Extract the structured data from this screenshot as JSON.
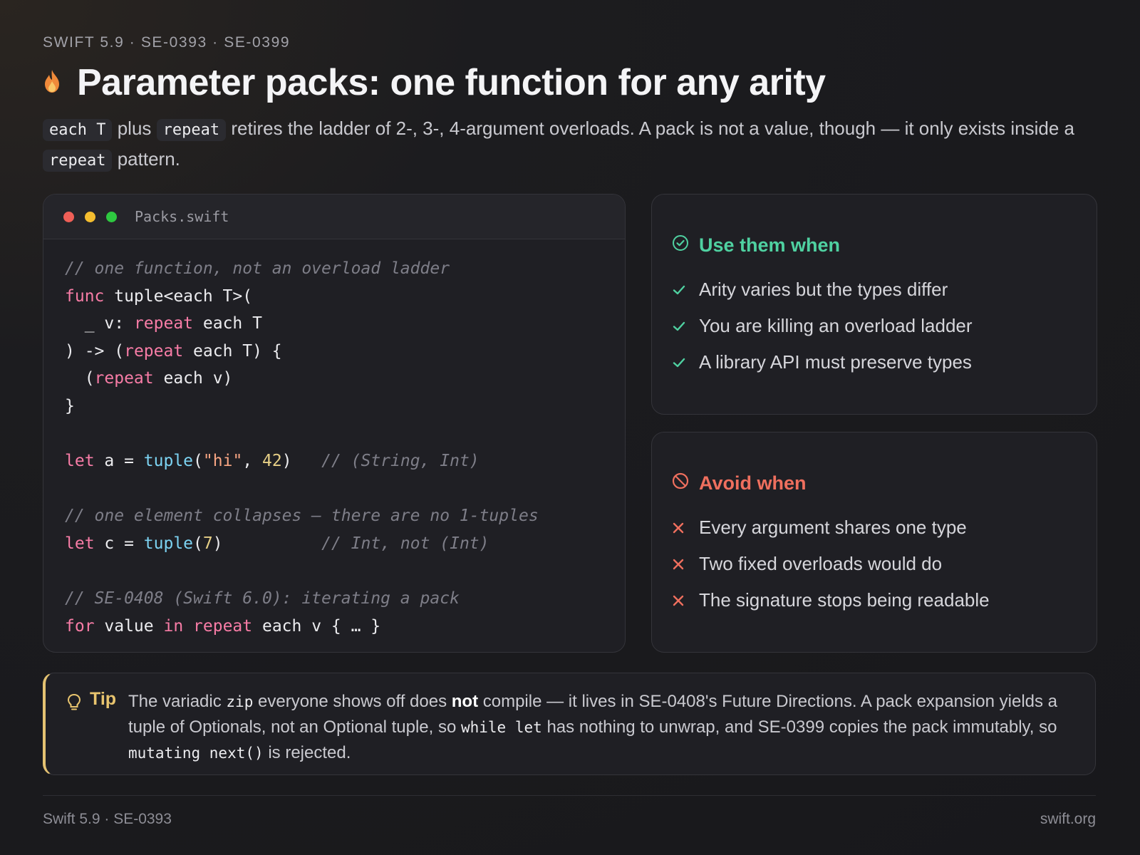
{
  "header": {
    "eyebrow": "SWIFT 5.9 · SE-0393 · SE-0399",
    "title": "Parameter packs: one function for any arity",
    "icon": "flame-icon"
  },
  "lede": {
    "chip1": "each T",
    "t1": "plus",
    "chip2": "repeat",
    "t2": "retires the ladder of 2-, 3-, 4-argument overloads. A pack is not a value, though — it only exists inside a",
    "chip3": "repeat",
    "t3": "pattern."
  },
  "code_window": {
    "filename": "Packs.swift",
    "lines": [
      "// one function, not an overload ladder",
      "func tuple<each T>(",
      "  _ v: repeat each T",
      ") -> (repeat each T) {",
      "  (repeat each v)",
      "}",
      "",
      "let a = tuple(\"hi\", 42)   // (String, Int)",
      "",
      "// one element collapses — there are no 1-tuples",
      "let c = tuple(7)          // Int, not (Int)",
      "",
      "// SE-0408 (Swift 6.0): iterating a pack",
      "for value in repeat each v { … }"
    ]
  },
  "use_panel": {
    "title": "Use them when",
    "items": [
      "Arity varies but the types differ",
      "You are killing an overload ladder",
      "A library API must preserve types"
    ]
  },
  "avoid_panel": {
    "title": "Avoid when",
    "items": [
      "Every argument shares one type",
      "Two fixed overloads would do",
      "The signature stops being readable"
    ]
  },
  "tip": {
    "label": "Tip",
    "p1": "The variadic",
    "c1": "zip",
    "p2": "everyone shows off does",
    "bold": "not",
    "p3": "compile — it lives in SE-0408's Future Directions. A pack expansion yields a tuple of Optionals, not an Optional tuple, so",
    "c2": "while let",
    "p4": "has nothing to unwrap, and SE-0399 copies the pack immutably, so",
    "c3": "mutating next()",
    "p5": "is rejected."
  },
  "footer": {
    "left": "Swift 5.9 · SE-0393",
    "right": "swift.org"
  },
  "colors": {
    "accent_use": "#4fd1a1",
    "accent_avoid": "#ef6f5e",
    "accent_tip": "#e8c46e",
    "keyword": "#f77ca6",
    "function": "#7cd3f2"
  }
}
